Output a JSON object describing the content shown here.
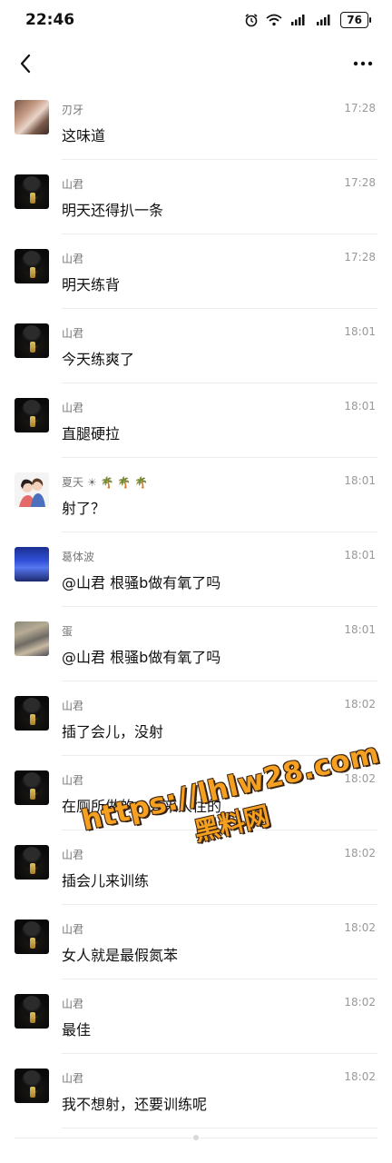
{
  "status_bar": {
    "time": "22:46",
    "battery": "76"
  },
  "messages": [
    {
      "sender": "刃牙",
      "time": "17:28",
      "text": "这味道",
      "avatar": "blade"
    },
    {
      "sender": "山君",
      "time": "17:28",
      "text": "明天还得扒一条",
      "avatar": "dark"
    },
    {
      "sender": "山君",
      "time": "17:28",
      "text": "明天练背",
      "avatar": "dark"
    },
    {
      "sender": "山君",
      "time": "18:01",
      "text": "今天练爽了",
      "avatar": "dark"
    },
    {
      "sender": "山君",
      "time": "18:01",
      "text": "直腿硬拉",
      "avatar": "dark"
    },
    {
      "sender": "夏天",
      "sender_emoji": "☀ 🌴 🌴 🌴",
      "time": "18:01",
      "text": "射了？",
      "avatar": "summer"
    },
    {
      "sender": "葛体波",
      "time": "18:01",
      "text": "@山君 根骚b做有氧了吗",
      "avatar": "ge"
    },
    {
      "sender": "蛋",
      "time": "18:01",
      "text": "@山君 根骚b做有氧了吗",
      "avatar": "egg"
    },
    {
      "sender": "山君",
      "time": "18:02",
      "text": "插了会儿，没射",
      "avatar": "dark"
    },
    {
      "sender": "山君",
      "time": "18:02",
      "text": "在厕所做的，人来人往的",
      "avatar": "dark"
    },
    {
      "sender": "山君",
      "time": "18:02",
      "text": "插会儿来训练",
      "avatar": "dark"
    },
    {
      "sender": "山君",
      "time": "18:02",
      "text": "女人就是最假氮苯",
      "avatar": "dark"
    },
    {
      "sender": "山君",
      "time": "18:02",
      "text": "最佳",
      "avatar": "dark"
    },
    {
      "sender": "山君",
      "time": "18:02",
      "text": "我不想射，还要训练呢",
      "avatar": "dark"
    }
  ],
  "watermark": {
    "url": "https://lhlw28.com",
    "name": "黑料网"
  }
}
